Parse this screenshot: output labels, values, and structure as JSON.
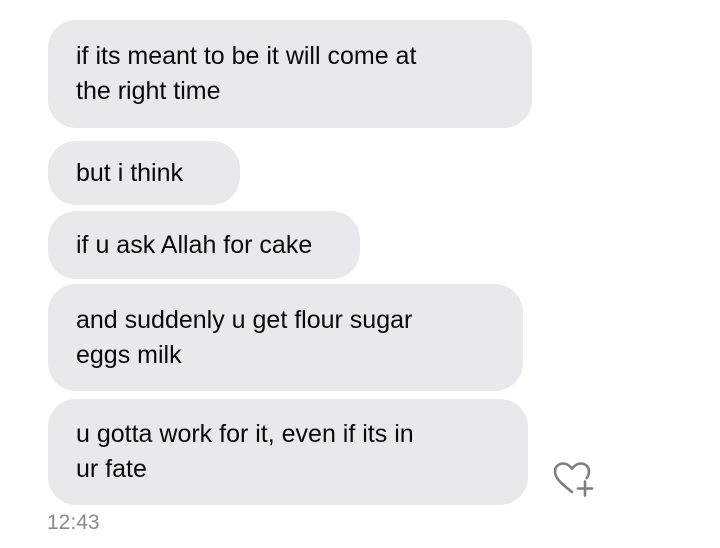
{
  "conversation": {
    "messages": [
      {
        "text": "if its meant to be it will come at\nthe right time"
      },
      {
        "text": "but i think"
      },
      {
        "text": "if u ask Allah for cake"
      },
      {
        "text": "and suddenly u get flour sugar\neggs milk"
      },
      {
        "text": "u gotta work for it, even if its in\nur fate"
      }
    ],
    "timestamp": "12:43",
    "reaction_icon": "heart-plus-icon"
  },
  "colors": {
    "bubble_background": "#e9e9eb",
    "message_text": "#0a0a0a",
    "timestamp_text": "#8a8a8e",
    "icon_stroke": "#7d7d82"
  }
}
